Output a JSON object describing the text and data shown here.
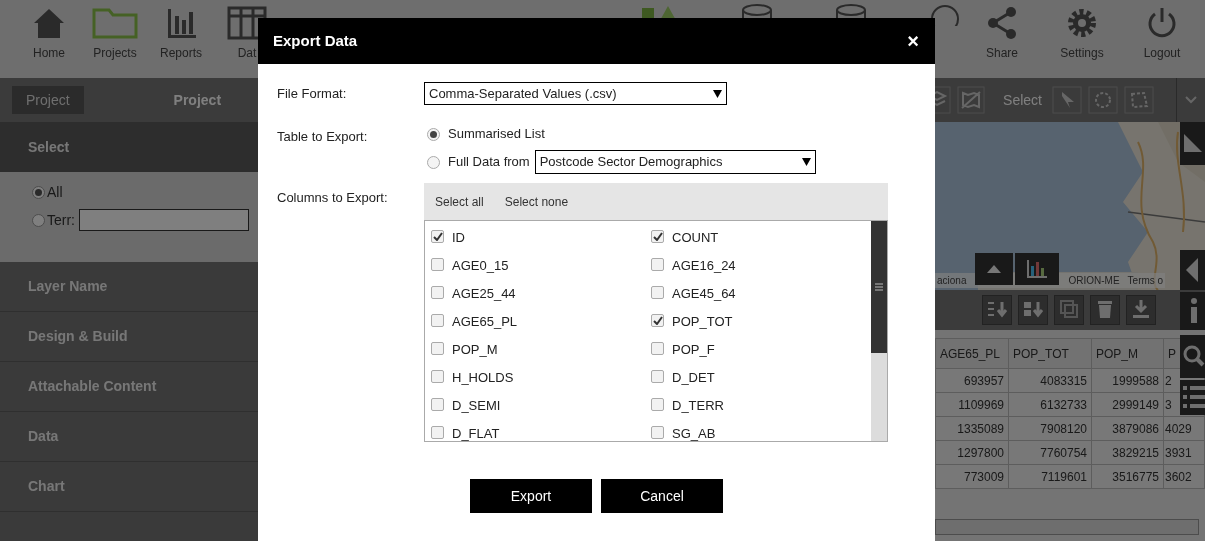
{
  "top_nav": {
    "items": [
      {
        "label": "Home",
        "kind": "home"
      },
      {
        "label": "Projects",
        "kind": "folder"
      },
      {
        "label": "Reports",
        "kind": "chart"
      },
      {
        "label": "Dat",
        "kind": "grid"
      }
    ],
    "right_items": [
      {
        "label": "Share",
        "kind": "share"
      },
      {
        "label": "Settings",
        "kind": "gear"
      },
      {
        "label": "Logout",
        "kind": "power"
      }
    ]
  },
  "project_bar": {
    "back": "Project",
    "title": "Project",
    "select_label": "Select"
  },
  "sidebar": {
    "header": "Select",
    "options": [
      {
        "label": "All",
        "selected": true
      },
      {
        "label": "Terr:",
        "selected": false
      }
    ],
    "sections": [
      "Layer Name",
      "Design & Build",
      "Attachable Content",
      "Data",
      "Chart"
    ]
  },
  "map": {
    "attribution": [
      "aciona",
      "ORION-ME",
      "Terms o"
    ]
  },
  "table": {
    "columns": [
      "AGE65_PL",
      "POP_TOT",
      "POP_M",
      "P"
    ],
    "rows": [
      [
        "693957",
        "4083315",
        "1999588",
        "2"
      ],
      [
        "1109969",
        "6132733",
        "2999149",
        "3"
      ],
      [
        "1335089",
        "7908120",
        "3879086",
        "4029"
      ],
      [
        "1297800",
        "7760754",
        "3829215",
        "3931"
      ],
      [
        "773009",
        "7119601",
        "3516775",
        "3602"
      ]
    ]
  },
  "dialog": {
    "title": "Export Data",
    "close": "×",
    "file_format": {
      "label": "File Format:",
      "value": "Comma-Separated Values (.csv)"
    },
    "table_to_export": {
      "label": "Table to Export:",
      "options": [
        {
          "label": "Summarised List",
          "selected": true
        },
        {
          "label": "Full Data from",
          "selected": false
        }
      ],
      "source": "Postcode Sector Demographics"
    },
    "columns": {
      "label": "Columns to Export:",
      "select_all": "Select all",
      "select_none": "Select none",
      "items": [
        {
          "label": "ID",
          "checked": true
        },
        {
          "label": "COUNT",
          "checked": true
        },
        {
          "label": "AGE0_15",
          "checked": false
        },
        {
          "label": "AGE16_24",
          "checked": false
        },
        {
          "label": "AGE25_44",
          "checked": false
        },
        {
          "label": "AGE45_64",
          "checked": false
        },
        {
          "label": "AGE65_PL",
          "checked": false
        },
        {
          "label": "POP_TOT",
          "checked": true
        },
        {
          "label": "POP_M",
          "checked": false
        },
        {
          "label": "POP_F",
          "checked": false
        },
        {
          "label": "H_HOLDS",
          "checked": false
        },
        {
          "label": "D_DET",
          "checked": false
        },
        {
          "label": "D_SEMI",
          "checked": false
        },
        {
          "label": "D_TERR",
          "checked": false
        },
        {
          "label": "D_FLAT",
          "checked": false
        },
        {
          "label": "SG_AB",
          "checked": false
        }
      ]
    },
    "buttons": [
      "Export",
      "Cancel"
    ]
  }
}
